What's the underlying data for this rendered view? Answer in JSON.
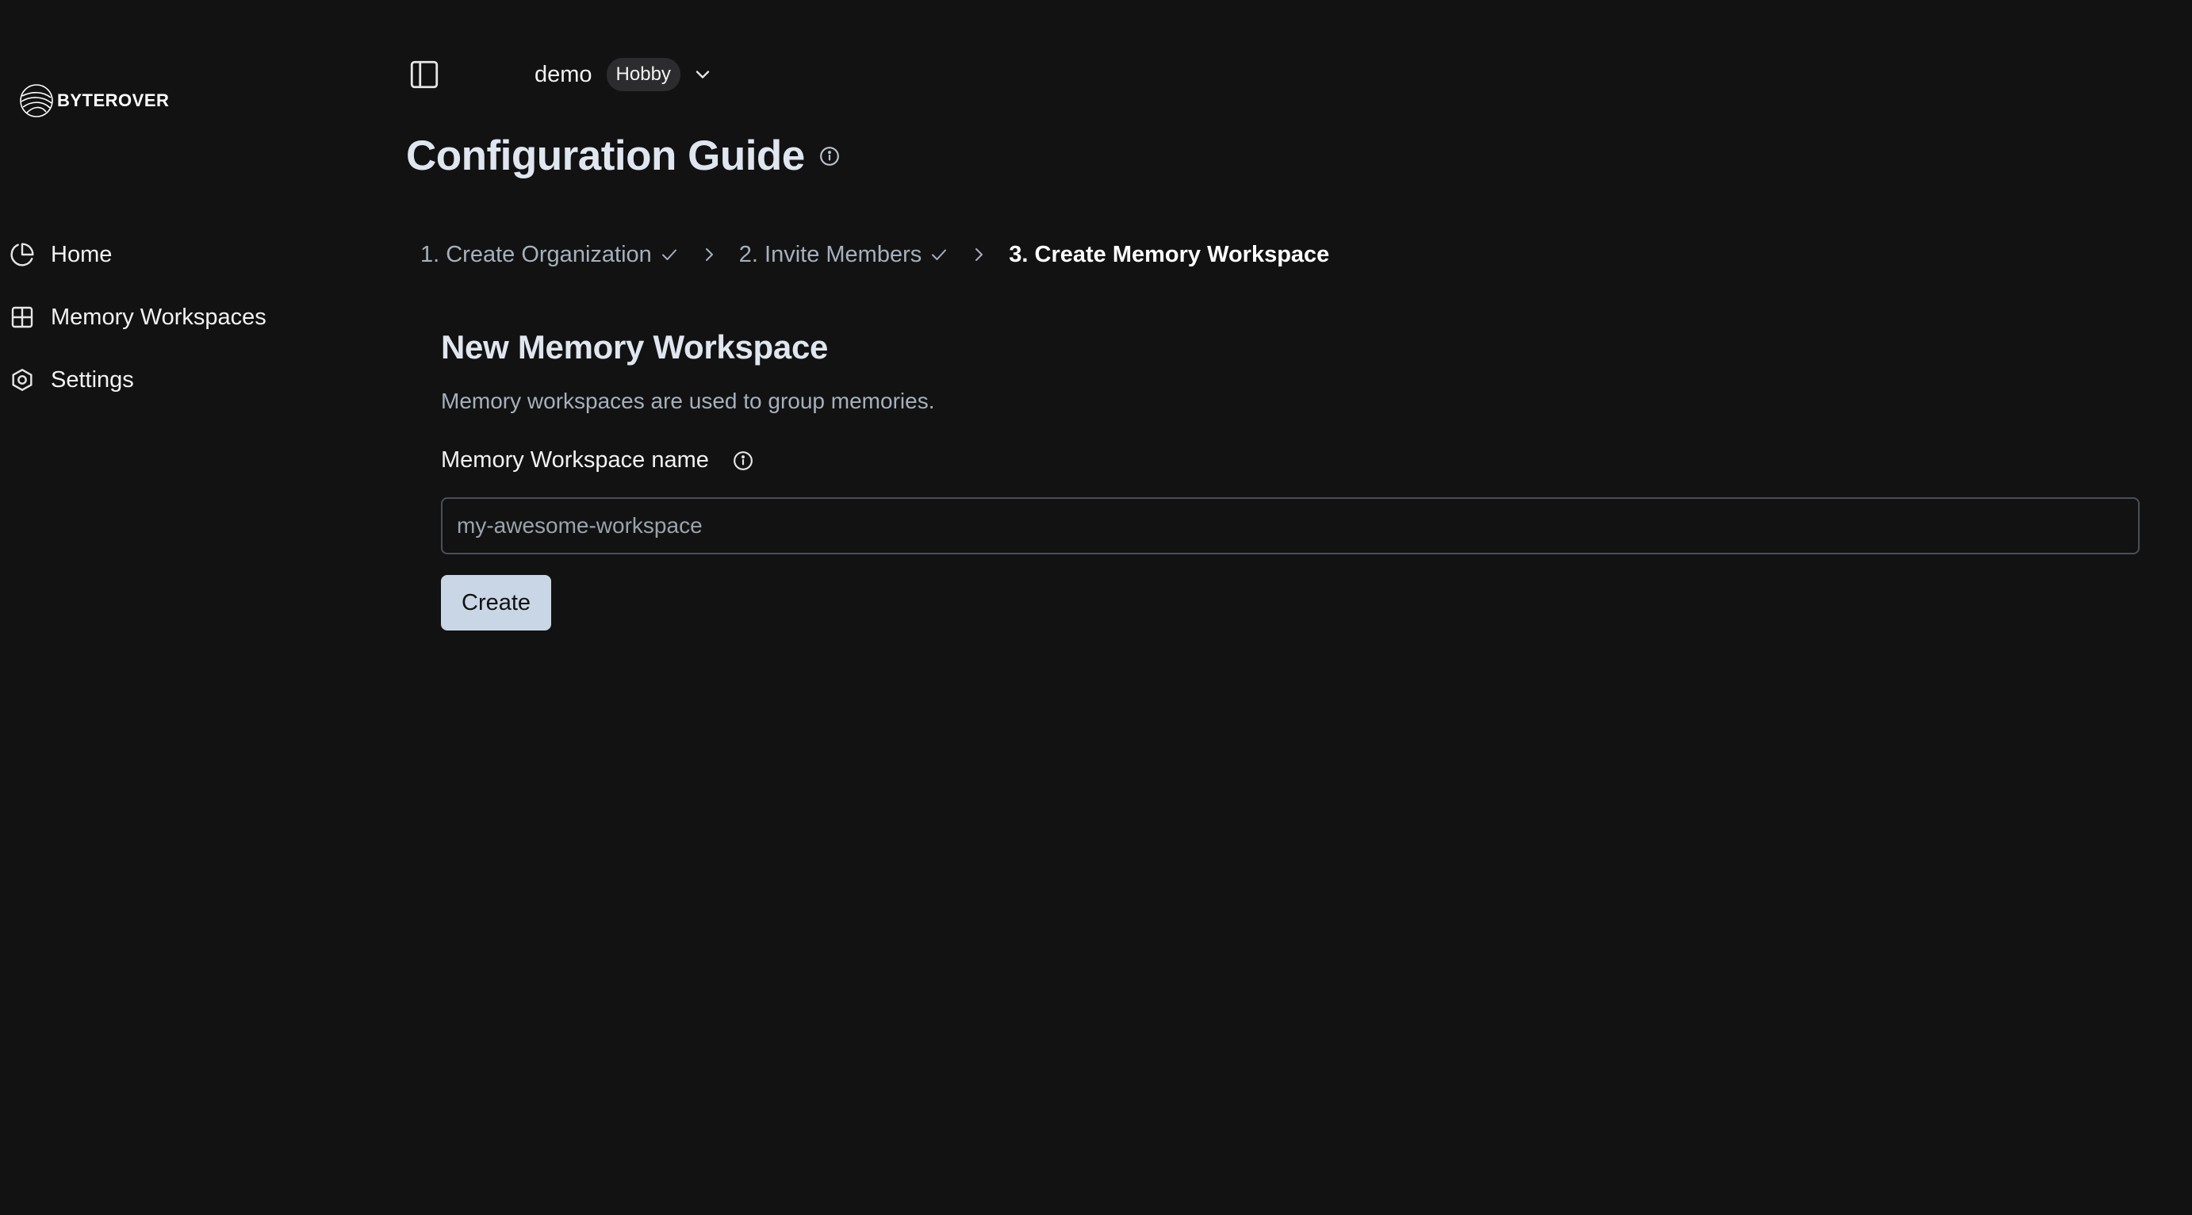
{
  "brand": {
    "name": "BYTEROVER",
    "logo_icon": "globe-swirl-icon"
  },
  "sidebar": {
    "items": [
      {
        "label": "Home",
        "icon": "pie-chart-icon"
      },
      {
        "label": "Memory Workspaces",
        "icon": "grid-icon"
      },
      {
        "label": "Settings",
        "icon": "gear-icon"
      }
    ]
  },
  "header": {
    "org_name": "demo",
    "plan": "Hobby",
    "page_title": "Configuration Guide"
  },
  "stepper": {
    "steps": [
      {
        "label": "1. Create Organization",
        "status": "complete"
      },
      {
        "label": "2. Invite Members",
        "status": "complete"
      },
      {
        "label": "3. Create Memory Workspace",
        "status": "current"
      }
    ]
  },
  "form": {
    "title": "New Memory Workspace",
    "description": "Memory workspaces are used to group memories.",
    "name_label": "Memory Workspace name",
    "name_placeholder": "my-awesome-workspace",
    "name_value": "",
    "submit_label": "Create"
  },
  "colors": {
    "background": "#121212",
    "primary_button": "#c9d6e6",
    "muted_text": "#a6b0bd",
    "badge_bg": "#2c2c2e"
  }
}
